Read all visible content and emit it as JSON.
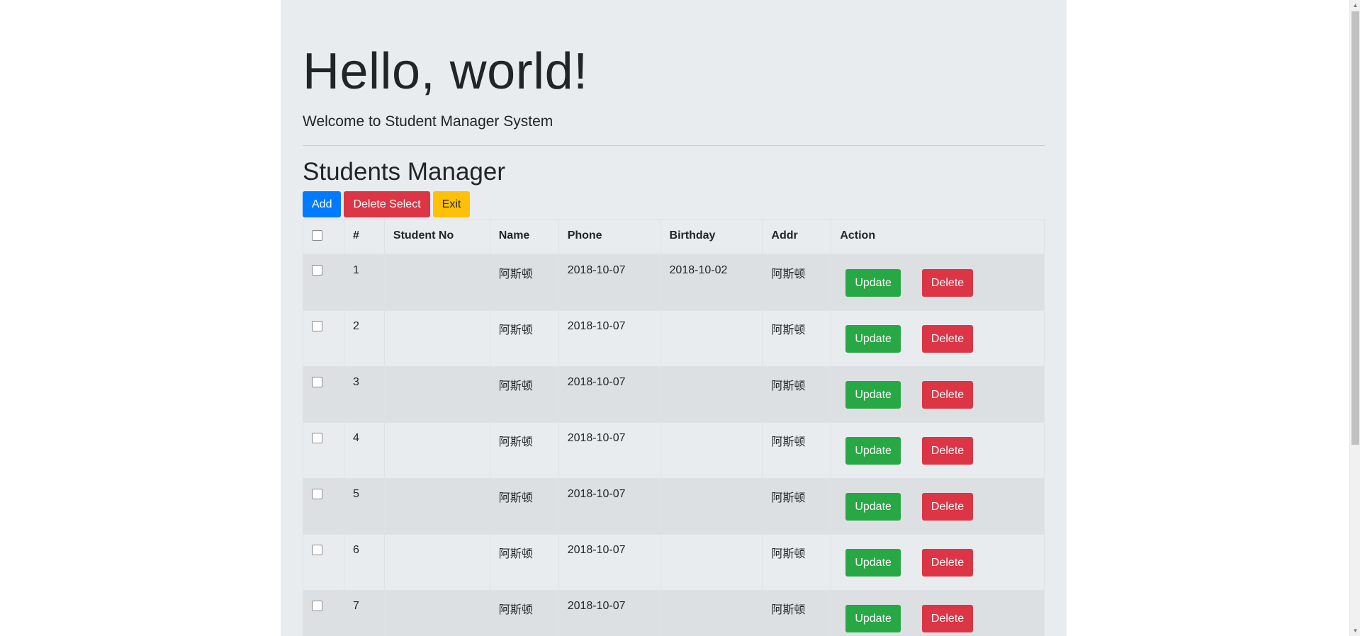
{
  "hero": {
    "title": "Hello, world!",
    "subtitle": "Welcome to Student Manager System"
  },
  "section": {
    "title": "Students Manager"
  },
  "toolbar": {
    "add_label": "Add",
    "delete_select_label": "Delete Select",
    "exit_label": "Exit"
  },
  "table": {
    "headers": [
      "#",
      "Student No",
      "Name",
      "Phone",
      "Birthday",
      "Addr",
      "Action"
    ],
    "update_label": "Update",
    "delete_label": "Delete",
    "rows": [
      {
        "id": "1",
        "student_no": "",
        "name": "阿斯顿",
        "phone": "2018-10-07",
        "birthday": "2018-10-02",
        "addr": "阿斯顿"
      },
      {
        "id": "2",
        "student_no": "",
        "name": "阿斯顿",
        "phone": "2018-10-07",
        "birthday": "",
        "addr": "阿斯顿"
      },
      {
        "id": "3",
        "student_no": "",
        "name": "阿斯顿",
        "phone": "2018-10-07",
        "birthday": "",
        "addr": "阿斯顿"
      },
      {
        "id": "4",
        "student_no": "",
        "name": "阿斯顿",
        "phone": "2018-10-07",
        "birthday": "",
        "addr": "阿斯顿"
      },
      {
        "id": "5",
        "student_no": "",
        "name": "阿斯顿",
        "phone": "2018-10-07",
        "birthday": "",
        "addr": "阿斯顿"
      },
      {
        "id": "6",
        "student_no": "",
        "name": "阿斯顿",
        "phone": "2018-10-07",
        "birthday": "",
        "addr": "阿斯顿"
      },
      {
        "id": "7",
        "student_no": "",
        "name": "阿斯顿",
        "phone": "2018-10-07",
        "birthday": "",
        "addr": "阿斯顿"
      }
    ]
  },
  "colors": {
    "primary": "#007bff",
    "danger": "#dc3545",
    "warning": "#ffc107",
    "success": "#28a745",
    "jumbotron_bg": "#e9ecef"
  }
}
